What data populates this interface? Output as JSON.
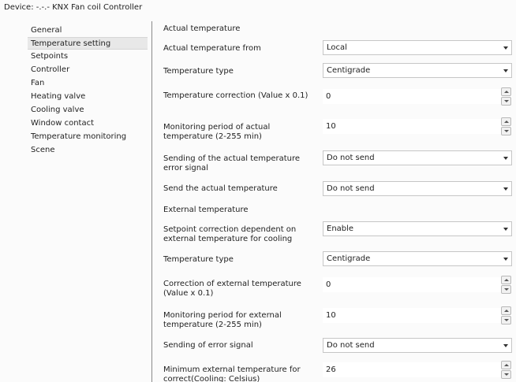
{
  "window": {
    "title": "Device: -.-.-  KNX Fan coil Controller"
  },
  "sidebar": {
    "items": [
      {
        "label": "General"
      },
      {
        "label": "Temperature setting",
        "selected": true
      },
      {
        "label": "Setpoints"
      },
      {
        "label": "Controller"
      },
      {
        "label": "Fan"
      },
      {
        "label": "Heating valve"
      },
      {
        "label": "Cooling valve"
      },
      {
        "label": "Window contact"
      },
      {
        "label": "Temperature monitoring"
      },
      {
        "label": "Scene"
      }
    ]
  },
  "main": {
    "section_actual": "Actual temperature",
    "section_external": "External temperature",
    "rows": [
      {
        "label": "Actual temperature from",
        "value": "Local"
      },
      {
        "label": "Temperature type",
        "value": "Centigrade"
      },
      {
        "label": "Temperature correction (Value x 0.1)",
        "value": "0"
      },
      {
        "label": "Monitoring period of actual temperature (2-255 min)",
        "value": "10"
      },
      {
        "label": "Sending of the actual temperature error signal",
        "value": "Do not send"
      },
      {
        "label": "Send the actual temperature",
        "value": "Do not send"
      },
      {
        "label": "Setpoint correction dependent on external temperature for cooling",
        "value": "Enable"
      },
      {
        "label": "Temperature type",
        "value": "Centigrade"
      },
      {
        "label": "Correction of external temperature (Value x 0.1)",
        "value": "0"
      },
      {
        "label": "Monitoring period for external temperature (2-255 min)",
        "value": "10"
      },
      {
        "label": "Sending of error signal",
        "value": "Do not send"
      },
      {
        "label": "Minimum external temperature for correct(Cooling: Celsius)",
        "value": "26"
      }
    ]
  }
}
